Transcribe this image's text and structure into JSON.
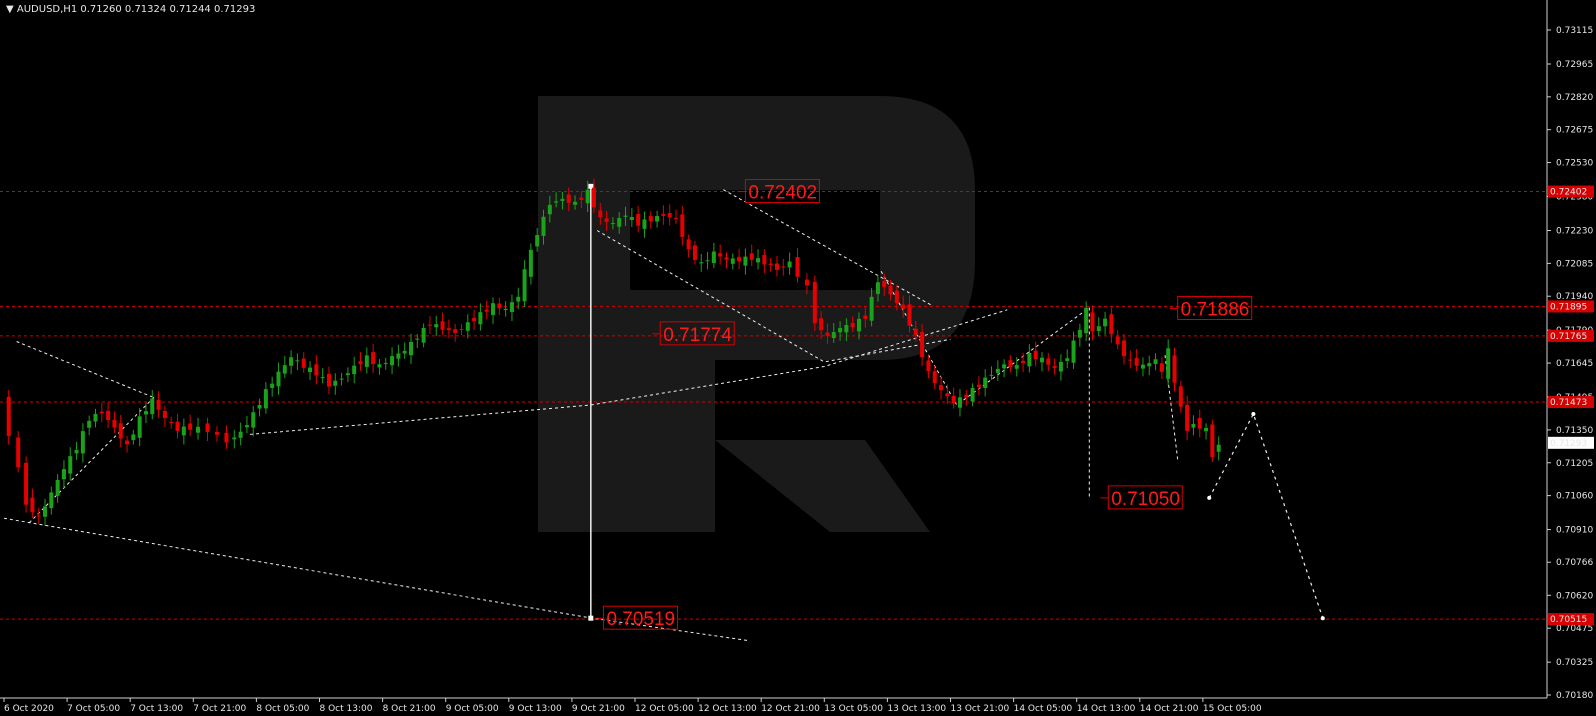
{
  "header": {
    "menu_glyph": "▼",
    "symbol_timeframe": "AUDUSD,H1",
    "ohlc": "0.71260 0.71324 0.71244 0.71293"
  },
  "chart_data": {
    "type": "candlestick",
    "symbol": "AUDUSD",
    "timeframe": "H1",
    "y_ticks": [
      "0.73115",
      "0.72965",
      "0.72820",
      "0.72675",
      "0.72530",
      "0.72380",
      "0.72230",
      "0.72085",
      "0.71940",
      "0.71790",
      "0.71645",
      "0.71495",
      "0.71350",
      "0.71205",
      "0.71060",
      "0.70910",
      "0.70766",
      "0.70620",
      "0.70475",
      "0.70325",
      "0.70180"
    ],
    "x_ticks": [
      "6 Oct 2020",
      "7 Oct 05:00",
      "7 Oct 13:00",
      "7 Oct 21:00",
      "8 Oct 05:00",
      "8 Oct 13:00",
      "8 Oct 21:00",
      "9 Oct 05:00",
      "9 Oct 13:00",
      "9 Oct 21:00",
      "12 Oct 05:00",
      "12 Oct 13:00",
      "12 Oct 21:00",
      "13 Oct 05:00",
      "13 Oct 13:00",
      "13 Oct 21:00",
      "14 Oct 05:00",
      "14 Oct 13:00",
      "14 Oct 21:00",
      "15 Oct 05:00"
    ],
    "current_price": "0.71293",
    "levels": [
      {
        "price": 0.72402,
        "axis_label": "0.72402"
      },
      {
        "price": 0.71895,
        "axis_label": "0.71895"
      },
      {
        "price": 0.71765,
        "axis_label": "0.71765"
      },
      {
        "price": 0.71473,
        "axis_label": "0.71473"
      },
      {
        "price": 0.70515,
        "axis_label": "0.70515"
      }
    ],
    "annotations": [
      {
        "text": "0.72402",
        "x": 20.2,
        "y": 0.72402
      },
      {
        "text": "0.71886",
        "x": 32.2,
        "y": 0.71886
      },
      {
        "text": "0.71774",
        "x": 12.6,
        "y": 0.71774
      },
      {
        "text": "0.71050",
        "x": 29.8,
        "y": 0.7105
      },
      {
        "text": "0.70519",
        "x": 9.8,
        "y": 0.70519
      }
    ],
    "projection": [
      [
        15.4,
        0.71473
      ],
      [
        16.0,
        0.7105
      ],
      [
        17.0,
        0.7147
      ],
      [
        18.0,
        0.70519
      ]
    ]
  }
}
